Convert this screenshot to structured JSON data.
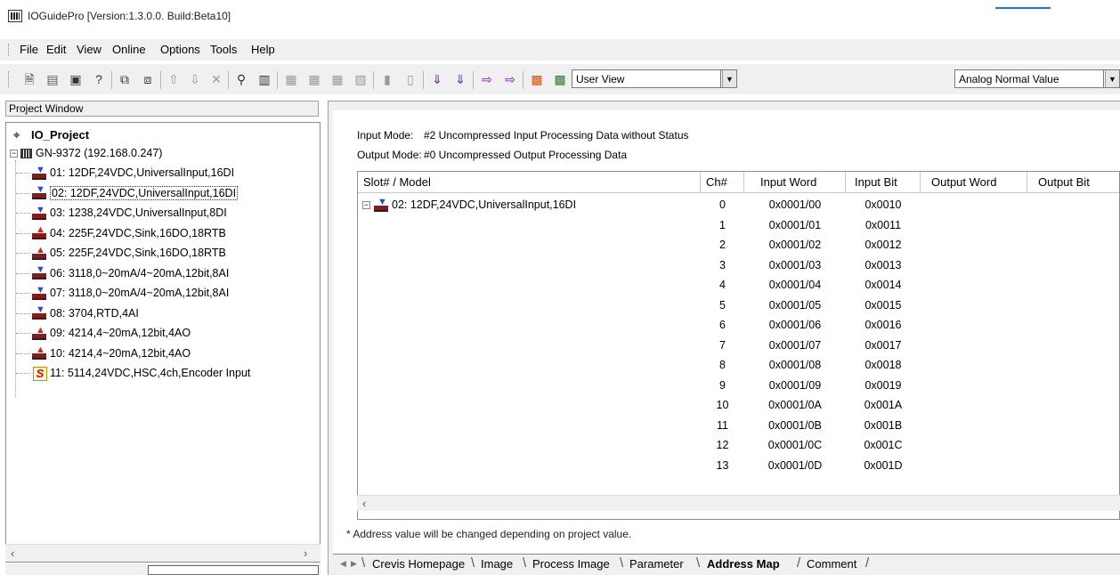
{
  "window": {
    "title": "IOGuidePro  [Version:1.3.0.0. Build:Beta10]"
  },
  "menu": [
    "File",
    "Edit",
    "View",
    "Online",
    "Options",
    "Tools",
    "Help"
  ],
  "toolbar": {
    "view_select": "User View",
    "value_select": "Analog Normal Value",
    "icons": [
      "new-file-icon",
      "open-icon",
      "save-icon",
      "help-icon",
      "copy-module-icon",
      "paste-module-icon",
      "move-up-icon",
      "move-down-icon",
      "delete-icon",
      "connect-icon",
      "scan-icon",
      "online-icon",
      "offline-icon",
      "download-icon",
      "upload-icon",
      "read-icon",
      "write-icon",
      "monitor-in-icon",
      "monitor-out-icon",
      "export-icon",
      "import-icon",
      "setting-a-icon",
      "setting-b-icon"
    ]
  },
  "project": {
    "header": "Project Window",
    "root": "IO_Project",
    "device": "GN-9372 (192.168.0.247)",
    "slots": [
      {
        "label": "01: 12DF,24VDC,UniversalInput,16DI",
        "kind": "input"
      },
      {
        "label": "02: 12DF,24VDC,UniversalInput,16DI",
        "kind": "input",
        "selected": true
      },
      {
        "label": "03: 1238,24VDC,UniversalInput,8DI",
        "kind": "input"
      },
      {
        "label": "04: 225F,24VDC,Sink,16DO,18RTB",
        "kind": "output"
      },
      {
        "label": "05: 225F,24VDC,Sink,16DO,18RTB",
        "kind": "output"
      },
      {
        "label": "06: 3118,0~20mA/4~20mA,12bit,8AI",
        "kind": "input"
      },
      {
        "label": "07: 3118,0~20mA/4~20mA,12bit,8AI",
        "kind": "input"
      },
      {
        "label": "08: 3704,RTD,4AI",
        "kind": "input"
      },
      {
        "label": "09: 4214,4~20mA,12bit,4AO",
        "kind": "output"
      },
      {
        "label": "10: 4214,4~20mA,12bit,4AO",
        "kind": "output"
      },
      {
        "label": "11: 5114,24VDC,HSC,4ch,Encoder Input",
        "kind": "special"
      }
    ]
  },
  "address_map": {
    "input_mode_label": "Input Mode:",
    "input_mode_value": "#2 Uncompressed Input Processing Data without Status",
    "output_mode_label": "Output Mode:",
    "output_mode_value": "#0 Uncompressed Output Processing Data",
    "columns": [
      "Slot# / Model",
      "Ch#",
      "Input Word",
      "Input Bit",
      "Output Word",
      "Output Bit"
    ],
    "module": "02: 12DF,24VDC,UniversalInput,16DI",
    "rows": [
      {
        "ch": "0",
        "word": "0x0001/00",
        "bit": "0x0010"
      },
      {
        "ch": "1",
        "word": "0x0001/01",
        "bit": "0x0011"
      },
      {
        "ch": "2",
        "word": "0x0001/02",
        "bit": "0x0012"
      },
      {
        "ch": "3",
        "word": "0x0001/03",
        "bit": "0x0013"
      },
      {
        "ch": "4",
        "word": "0x0001/04",
        "bit": "0x0014"
      },
      {
        "ch": "5",
        "word": "0x0001/05",
        "bit": "0x0015"
      },
      {
        "ch": "6",
        "word": "0x0001/06",
        "bit": "0x0016"
      },
      {
        "ch": "7",
        "word": "0x0001/07",
        "bit": "0x0017"
      },
      {
        "ch": "8",
        "word": "0x0001/08",
        "bit": "0x0018"
      },
      {
        "ch": "9",
        "word": "0x0001/09",
        "bit": "0x0019"
      },
      {
        "ch": "10",
        "word": "0x0001/0A",
        "bit": "0x001A"
      },
      {
        "ch": "11",
        "word": "0x0001/0B",
        "bit": "0x001B"
      },
      {
        "ch": "12",
        "word": "0x0001/0C",
        "bit": "0x001C"
      },
      {
        "ch": "13",
        "word": "0x0001/0D",
        "bit": "0x001D"
      }
    ],
    "note": "* Address value will be changed depending on project value."
  },
  "tabs": [
    {
      "label": "Crevis Homepage",
      "active": false
    },
    {
      "label": "Image",
      "active": false
    },
    {
      "label": "Process Image",
      "active": false
    },
    {
      "label": "Parameter",
      "active": false
    },
    {
      "label": "Address Map",
      "active": true
    },
    {
      "label": "Comment",
      "active": false
    }
  ]
}
